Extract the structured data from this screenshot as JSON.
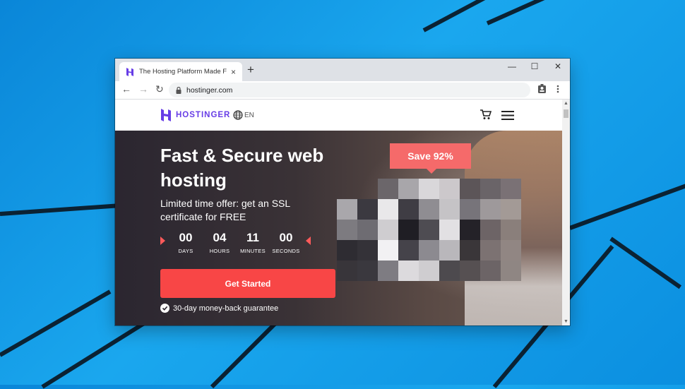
{
  "browser": {
    "tab_title": "The Hosting Platform Made For Y",
    "url": "hostinger.com",
    "new_tab": "+",
    "tab_close": "×",
    "window_controls": {
      "minimize": "—",
      "maximize": "☐",
      "close": "✕"
    },
    "nav": {
      "back": "←",
      "forward": "→",
      "reload": "↻"
    }
  },
  "site": {
    "brand": "HOSTINGER",
    "language": "EN",
    "brand_color": "#673de6"
  },
  "hero": {
    "headline": "Fast & Secure web hosting",
    "subheadline": "Limited time offer: get an SSL certificate for FREE",
    "badge": "Save 92%",
    "countdown": [
      {
        "value": "00",
        "label": "DAYS"
      },
      {
        "value": "04",
        "label": "HOURS"
      },
      {
        "value": "11",
        "label": "MINUTES"
      },
      {
        "value": "00",
        "label": "SECONDS"
      }
    ],
    "cta": "Get Started",
    "guarantee": "30-day money-back guarantee",
    "accent_color": "#f84646"
  },
  "icons": [
    "hostinger-logo-icon",
    "globe-icon",
    "cart-icon",
    "hamburger-menu-icon",
    "lock-icon",
    "profile-icon",
    "kebab-menu-icon",
    "check-circle-icon"
  ]
}
